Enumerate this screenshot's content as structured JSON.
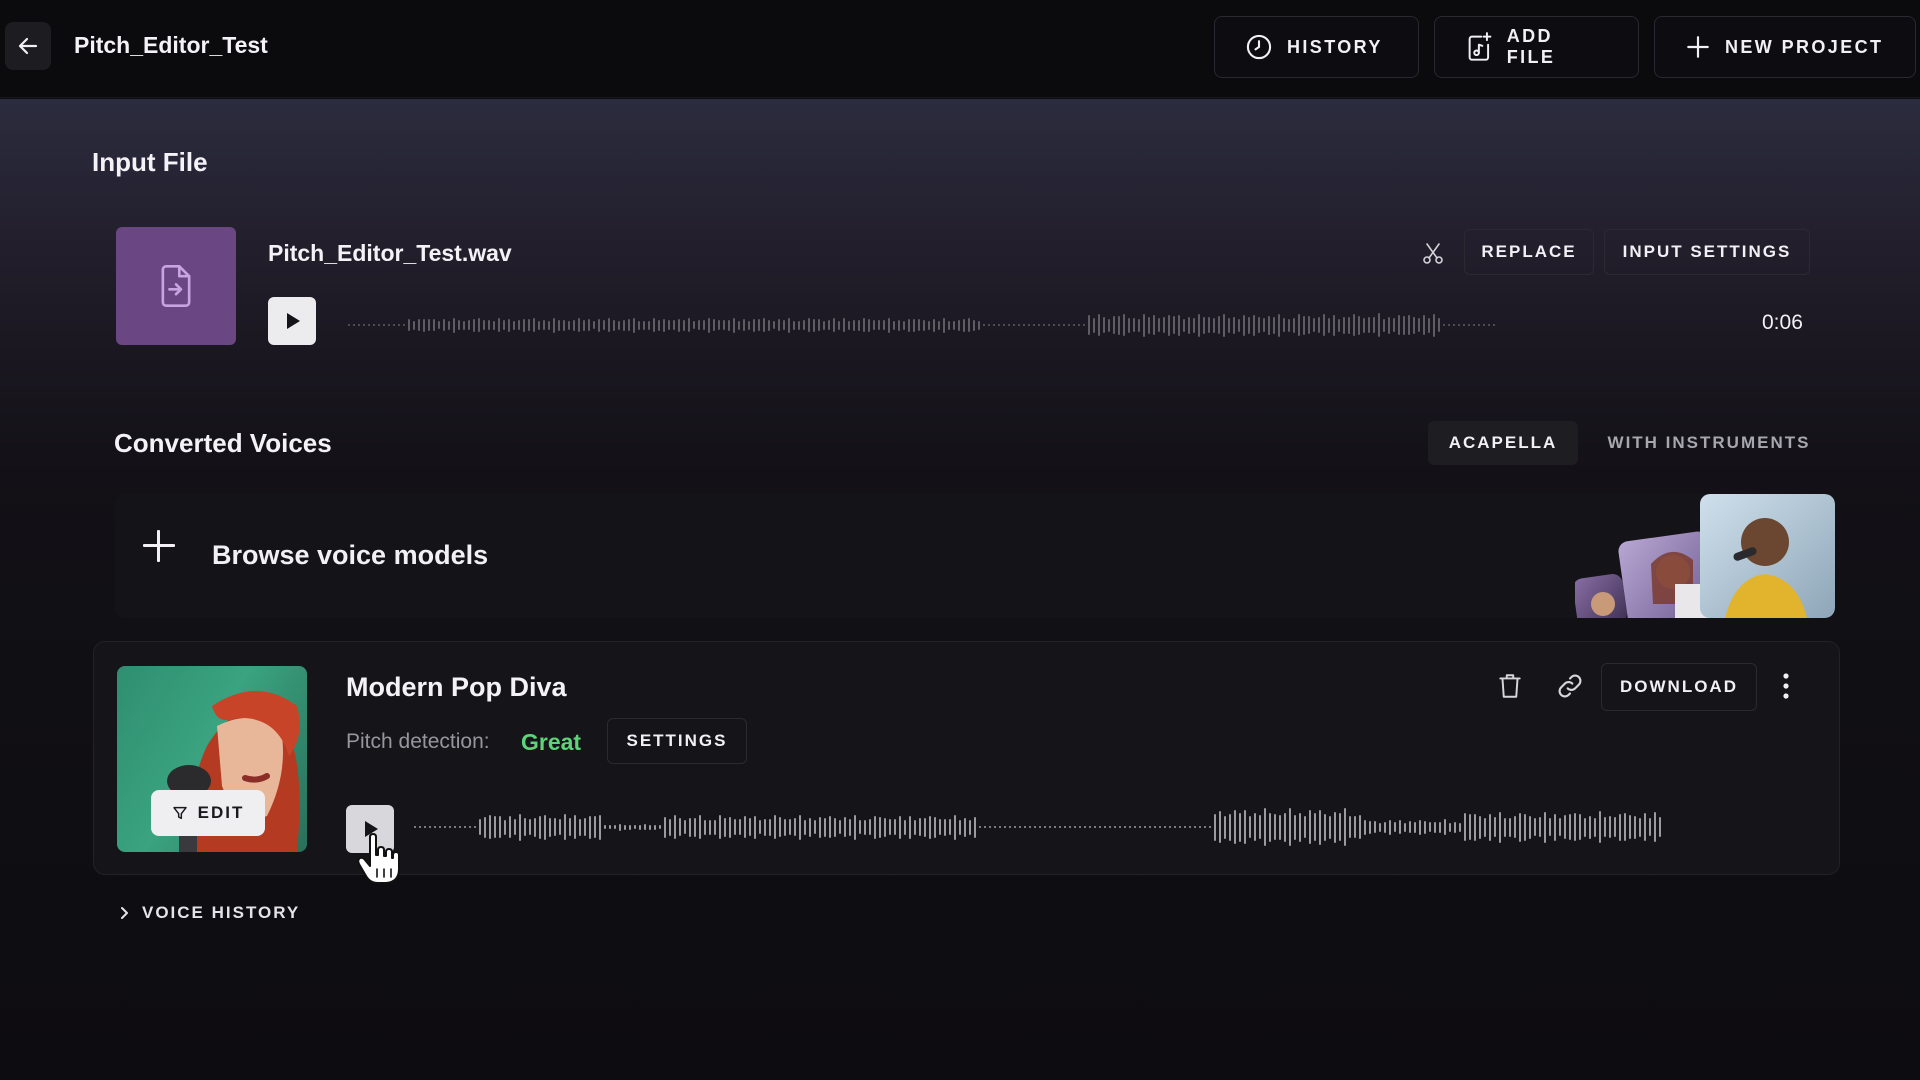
{
  "header": {
    "project_title": "Pitch_Editor_Test",
    "history_label": "HISTORY",
    "add_file_label": "ADD FILE",
    "new_project_label": "NEW PROJECT"
  },
  "input_file": {
    "section_title": "Input File",
    "file_name": "Pitch_Editor_Test.wav",
    "replace_label": "REPLACE",
    "input_settings_label": "INPUT SETTINGS",
    "duration": "0:06"
  },
  "converted": {
    "section_title": "Converted Voices",
    "tabs": [
      {
        "label": "ACAPELLA",
        "active": true
      },
      {
        "label": "WITH INSTRUMENTS",
        "active": false
      }
    ],
    "browse_label": "Browse voice models"
  },
  "voice_card": {
    "name": "Modern Pop Diva",
    "pitch_label": "Pitch detection:",
    "pitch_value": "Great",
    "settings_label": "SETTINGS",
    "download_label": "DOWNLOAD",
    "edit_label": "EDIT"
  },
  "voice_history_label": "VOICE HISTORY",
  "colors": {
    "accent_purple": "#6a4683",
    "great_green": "#5dd47a"
  },
  "icons": [
    "back-arrow-icon",
    "clock-icon",
    "add-music-file-icon",
    "plus-icon",
    "file-arrow-icon",
    "play-icon",
    "scissors-icon",
    "trash-icon",
    "link-icon",
    "kebab-menu-icon",
    "funnel-icon",
    "chevron-right-icon"
  ]
}
